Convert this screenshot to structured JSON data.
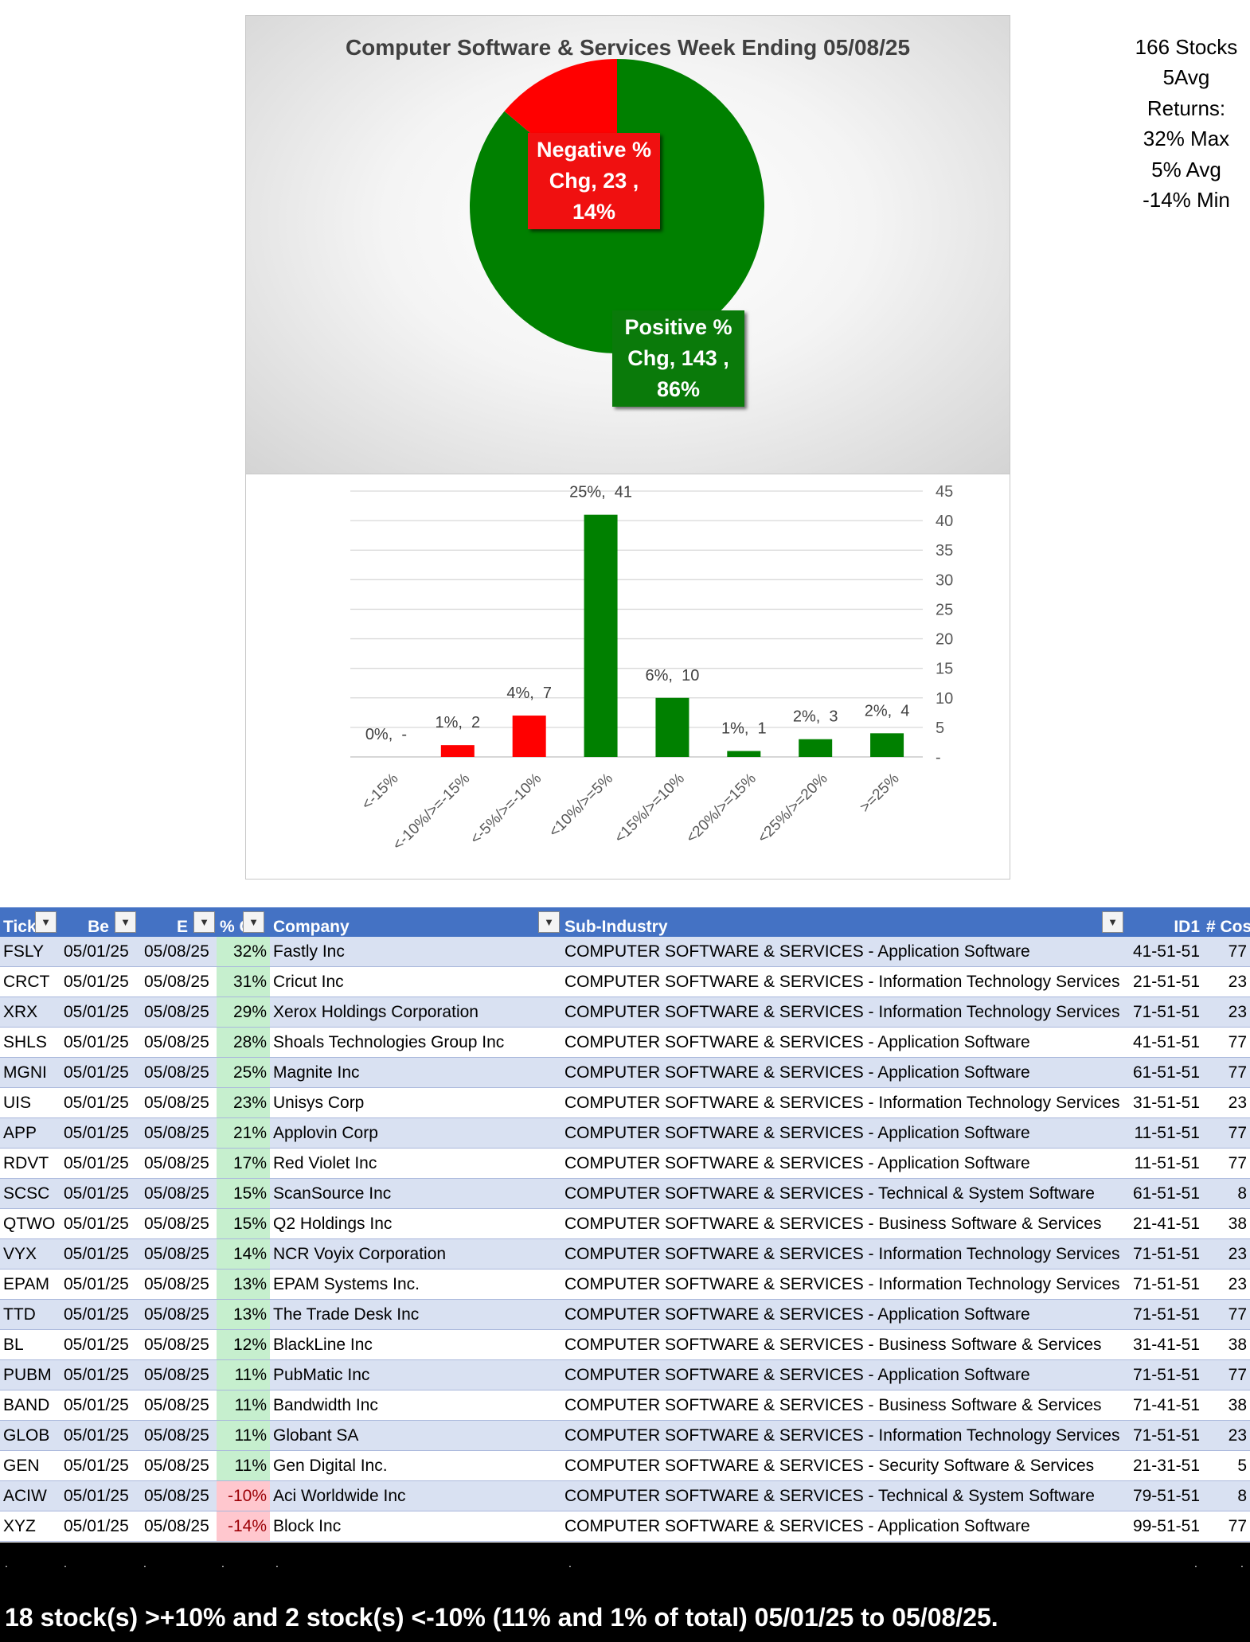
{
  "pie": {
    "title": "Computer Software & Services Week Ending 05/08/25",
    "slices": [
      {
        "name": "Negative % Chg",
        "lines": [
          "Negative %",
          "Chg,  23 ,",
          "14%"
        ],
        "count": 23,
        "pct": 14,
        "color": "#ff0000"
      },
      {
        "name": "Positive % Chg",
        "lines": [
          "Positive %",
          "Chg,  143 ,",
          "86%"
        ],
        "count": 143,
        "pct": 86,
        "color": "#008000"
      }
    ]
  },
  "stats": {
    "lines": [
      "166 Stocks",
      "5Avg",
      "Returns:",
      "32% Max",
      "5% Avg",
      "-14% Min"
    ]
  },
  "chart_data": [
    {
      "type": "pie",
      "title": "Computer Software & Services Week Ending 05/08/25",
      "categories": [
        "Negative % Chg",
        "Positive % Chg"
      ],
      "values": [
        23,
        143
      ],
      "percentages": [
        14,
        86
      ]
    },
    {
      "type": "bar",
      "categories": [
        "<-15%",
        "<-10%/>=-15%",
        "<-5%/>=-10%",
        "<10%/>=5%",
        "<15%/>=10%",
        "<20%/>=15%",
        "<25%/>=20%",
        ">=25%"
      ],
      "values": [
        0,
        2,
        7,
        41,
        10,
        1,
        3,
        4
      ],
      "data_labels": [
        "0%,  -",
        "1%,  2",
        "4%,  7",
        "25%,  41",
        "6%,  10",
        "1%,  1",
        "2%,  3",
        "2%,  4"
      ],
      "colors": [
        "#ff0000",
        "#ff0000",
        "#ff0000",
        "#008000",
        "#008000",
        "#008000",
        "#008000",
        "#008000"
      ],
      "yticks": [
        "-",
        "5",
        "10",
        "15",
        "20",
        "25",
        "30",
        "35",
        "40",
        "45"
      ],
      "ylim": [
        0,
        45
      ],
      "y_axis_side": "right",
      "grid": true
    }
  ],
  "table": {
    "headers": [
      "Tick",
      "Be",
      "E",
      "% C",
      "Company",
      "Sub-Industry",
      "ID1",
      "# Cos"
    ],
    "rows": [
      [
        "FSLY",
        "05/01/25",
        "05/08/25",
        "32%",
        "Fastly Inc",
        "COMPUTER SOFTWARE & SERVICES - Application Software",
        "41-51-51",
        "77"
      ],
      [
        "CRCT",
        "05/01/25",
        "05/08/25",
        "31%",
        "Cricut Inc",
        "COMPUTER SOFTWARE & SERVICES - Information Technology Services",
        "21-51-51",
        "23"
      ],
      [
        "XRX",
        "05/01/25",
        "05/08/25",
        "29%",
        "Xerox Holdings Corporation",
        "COMPUTER SOFTWARE & SERVICES - Information Technology Services",
        "71-51-51",
        "23"
      ],
      [
        "SHLS",
        "05/01/25",
        "05/08/25",
        "28%",
        "Shoals Technologies Group Inc",
        "COMPUTER SOFTWARE & SERVICES - Application Software",
        "41-51-51",
        "77"
      ],
      [
        "MGNI",
        "05/01/25",
        "05/08/25",
        "25%",
        "Magnite Inc",
        "COMPUTER SOFTWARE & SERVICES - Application Software",
        "61-51-51",
        "77"
      ],
      [
        "UIS",
        "05/01/25",
        "05/08/25",
        "23%",
        "Unisys Corp",
        "COMPUTER SOFTWARE & SERVICES - Information Technology Services",
        "31-51-51",
        "23"
      ],
      [
        "APP",
        "05/01/25",
        "05/08/25",
        "21%",
        "Applovin Corp",
        "COMPUTER SOFTWARE & SERVICES - Application Software",
        "11-51-51",
        "77"
      ],
      [
        "RDVT",
        "05/01/25",
        "05/08/25",
        "17%",
        "Red Violet Inc",
        "COMPUTER SOFTWARE & SERVICES - Application Software",
        "11-51-51",
        "77"
      ],
      [
        "SCSC",
        "05/01/25",
        "05/08/25",
        "15%",
        "ScanSource Inc",
        "COMPUTER SOFTWARE & SERVICES - Technical & System Software",
        "61-51-51",
        "8"
      ],
      [
        "QTWO",
        "05/01/25",
        "05/08/25",
        "15%",
        "Q2 Holdings Inc",
        "COMPUTER SOFTWARE & SERVICES - Business Software & Services",
        "21-41-51",
        "38"
      ],
      [
        "VYX",
        "05/01/25",
        "05/08/25",
        "14%",
        "NCR Voyix Corporation",
        "COMPUTER SOFTWARE & SERVICES - Information Technology Services",
        "71-51-51",
        "23"
      ],
      [
        "EPAM",
        "05/01/25",
        "05/08/25",
        "13%",
        "EPAM Systems Inc.",
        "COMPUTER SOFTWARE & SERVICES - Information Technology Services",
        "71-51-51",
        "23"
      ],
      [
        "TTD",
        "05/01/25",
        "05/08/25",
        "13%",
        "The Trade Desk Inc",
        "COMPUTER SOFTWARE & SERVICES - Application Software",
        "71-51-51",
        "77"
      ],
      [
        "BL",
        "05/01/25",
        "05/08/25",
        "12%",
        "BlackLine Inc",
        "COMPUTER SOFTWARE & SERVICES - Business Software & Services",
        "31-41-51",
        "38"
      ],
      [
        "PUBM",
        "05/01/25",
        "05/08/25",
        "11%",
        "PubMatic Inc",
        "COMPUTER SOFTWARE & SERVICES - Application Software",
        "71-51-51",
        "77"
      ],
      [
        "BAND",
        "05/01/25",
        "05/08/25",
        "11%",
        "Bandwidth Inc",
        "COMPUTER SOFTWARE & SERVICES - Business Software & Services",
        "71-41-51",
        "38"
      ],
      [
        "GLOB",
        "05/01/25",
        "05/08/25",
        "11%",
        "Globant SA",
        "COMPUTER SOFTWARE & SERVICES - Information Technology Services",
        "71-51-51",
        "23"
      ],
      [
        "GEN",
        "05/01/25",
        "05/08/25",
        "11%",
        "Gen Digital Inc.",
        "COMPUTER SOFTWARE & SERVICES - Security Software & Services",
        "21-31-51",
        "5"
      ],
      [
        "ACIW",
        "05/01/25",
        "05/08/25",
        "-10%",
        "Aci Worldwide Inc",
        "COMPUTER SOFTWARE & SERVICES - Technical & System Software",
        "79-51-51",
        "8"
      ],
      [
        "XYZ",
        "05/01/25",
        "05/08/25",
        "-14%",
        "Block Inc",
        "COMPUTER SOFTWARE & SERVICES - Application Software",
        "99-51-51",
        "77"
      ]
    ]
  },
  "footer": {
    "dots": [
      ".",
      ".",
      ".",
      ".",
      ".",
      ".",
      ".",
      "."
    ],
    "summary": "18 stock(s) >+10% and 2 stock(s) <-10% (11% and 1% of total) 05/01/25 to 05/08/25."
  },
  "colors": {
    "header_blue": "#4472c4",
    "band_blue": "#d9e1f2",
    "pos_green_fill": "#c6efce",
    "neg_red_fill": "#ffc7ce",
    "neg_red_text": "#9c0006"
  }
}
